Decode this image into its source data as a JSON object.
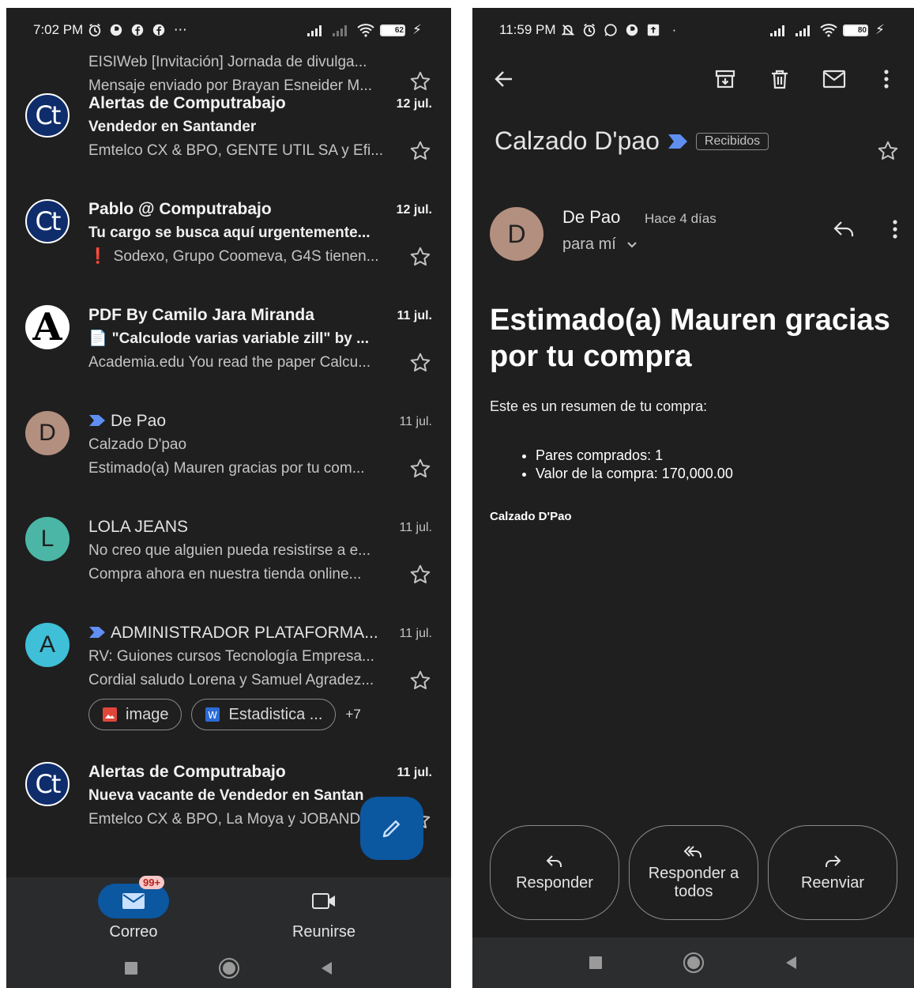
{
  "left": {
    "status": {
      "time": "7:02 PM",
      "battery": "62",
      "battery_fraction": 0.62
    },
    "partial_row": {
      "subject": "EISIWeb  [Invitación] Jornada de divulga...",
      "snippet": "Mensaje enviado por Brayan Esneider M..."
    },
    "messages": [
      {
        "avatar": "Ct",
        "avatar_type": "computrabajo-logo",
        "sender": "Alertas de Computrabajo",
        "date": "12 jul.",
        "unread": true,
        "subject": "Vendedor en Santander",
        "snippet": "Emtelco CX & BPO, GENTE UTIL SA y Efi..."
      },
      {
        "avatar": "Ct",
        "avatar_type": "computrabajo-logo",
        "sender": "Pablo @ Computrabajo",
        "date": "12 jul.",
        "unread": true,
        "subject": "Tu cargo se busca aquí urgentemente...",
        "snippet_mark": "❗",
        "snippet": "Sodexo, Grupo Coomeva, G4S tienen..."
      },
      {
        "avatar": "A",
        "avatar_type": "academia-logo",
        "sender": "PDF By Camilo Jara Miranda",
        "date": "11 jul.",
        "unread": true,
        "subject_mark": "📄",
        "subject": "\"Calculode varias variable zill\" by ...",
        "snippet": "Academia.edu You read the paper Calcu..."
      },
      {
        "avatar": "D",
        "avatar_color": "#b38f7f",
        "sender": "De Pao",
        "important": true,
        "date": "11 jul.",
        "unread": false,
        "subject": "Calzado D'pao",
        "snippet": "Estimado(a) Mauren gracias por tu com..."
      },
      {
        "avatar": "L",
        "avatar_color": "#4cb6a6",
        "sender": "LOLA JEANS",
        "date": "11 jul.",
        "unread": false,
        "subject": "No creo que alguien pueda resistirse a e...",
        "snippet": "Compra ahora en nuestra tienda online..."
      },
      {
        "avatar": "A",
        "avatar_color": "#3fc0d8",
        "sender": "ADMINISTRADOR PLATAFORMA...",
        "important": true,
        "date": "11 jul.",
        "unread": false,
        "subject": "RV: Guiones cursos Tecnología Empresa...",
        "snippet": "Cordial saludo Lorena y Samuel Agradez...",
        "attachments": [
          "image",
          "Estadistica ..."
        ],
        "attachments_more": "+7"
      },
      {
        "avatar": "Ct",
        "avatar_type": "computrabajo-logo",
        "sender": "Alertas de Computrabajo",
        "date": "11 jul.",
        "unread": true,
        "subject": "Nueva vacante de Vendedor en Santander",
        "snippet": "Emtelco CX & BPO, La Moya y JOBANDT..."
      }
    ],
    "nav": {
      "mail_label": "Correo",
      "mail_badge": "99+",
      "meet_label": "Reunirse"
    }
  },
  "right": {
    "status": {
      "time": "11:59 PM",
      "battery": "80",
      "battery_fraction": 0.8
    },
    "email": {
      "subject": "Calzado D'pao",
      "label": "Recibidos",
      "sender_initial": "D",
      "sender": "De Pao",
      "time_ago": "Hace 4 días",
      "recipient": "para mí",
      "heading": "Estimado(a) Mauren gracias por tu compra",
      "intro": "Este es un resumen de tu compra:",
      "summary": [
        "Pares comprados: 1",
        "Valor de la compra: 170,000.00"
      ],
      "signature": "Calzado D'Pao"
    },
    "actions": {
      "reply": "Responder",
      "reply_all": "Responder a todos",
      "forward": "Reenviar"
    }
  },
  "colors": {
    "background": "#1f1f1f",
    "accent_blue": "#0b57a0",
    "important_marker": "#5f8ff2",
    "attachment_red": "#e0463a",
    "attachment_word": "#2b6bd6"
  }
}
